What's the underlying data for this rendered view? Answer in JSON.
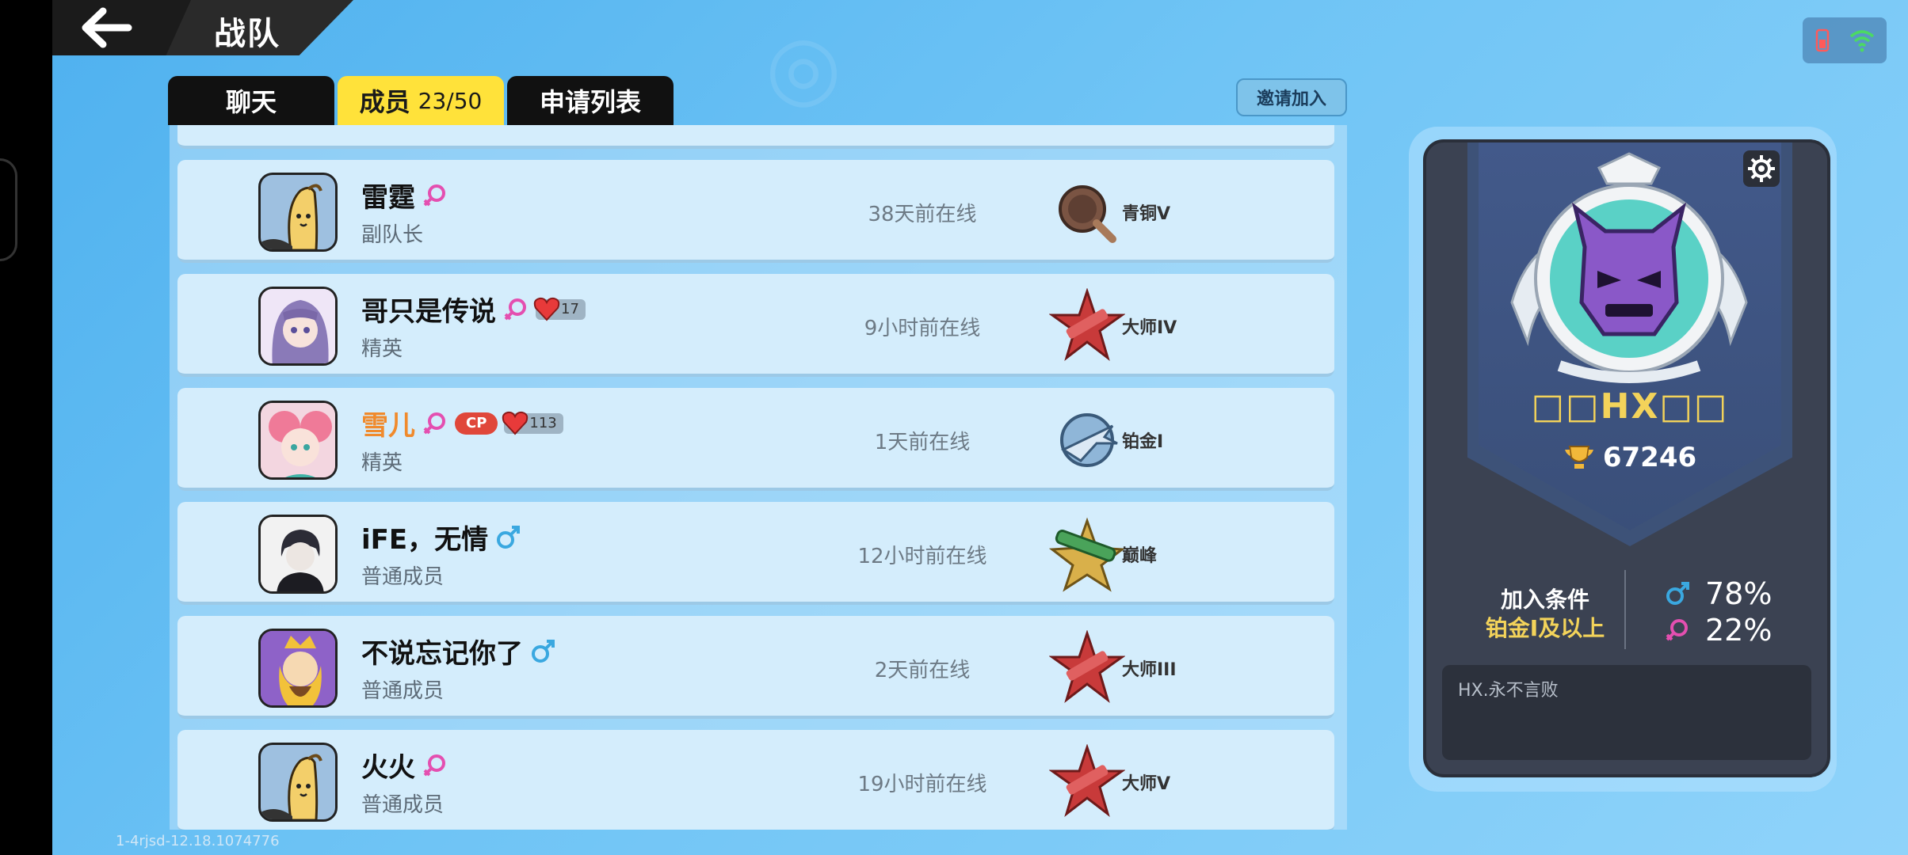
{
  "header": {
    "title": "战队",
    "back_icon": "arrow-left-icon"
  },
  "tabs": [
    {
      "label": "聊天",
      "active": false
    },
    {
      "label": "成员",
      "count": "23/50",
      "active": true
    },
    {
      "label": "申请列表",
      "active": false
    }
  ],
  "invite_label": "邀请加入",
  "members": [
    {
      "name": "雷霆",
      "gender": "female",
      "role": "副队长",
      "online": "38天前在线",
      "rank": "青铜V",
      "rank_icon": "bronze-pan-icon"
    },
    {
      "name": "哥只是传说",
      "gender": "female",
      "hearts": "17",
      "role": "精英",
      "online": "9小时前在线",
      "rank": "大师IV",
      "rank_icon": "master-star-icon"
    },
    {
      "name": "雪儿",
      "gender": "female",
      "cp": "CP",
      "hearts": "113",
      "role": "精英",
      "online": "1天前在线",
      "rank": "铂金I",
      "rank_icon": "platinum-jet-icon"
    },
    {
      "name": "iFE，无情",
      "gender": "male",
      "role": "普通成员",
      "online": "12小时前在线",
      "rank": "巅峰",
      "rank_icon": "peak-rocket-icon"
    },
    {
      "name": "不说忘记你了",
      "gender": "male",
      "role": "普通成员",
      "online": "2天前在线",
      "rank": "大师III",
      "rank_icon": "master-star-icon"
    },
    {
      "name": "火火",
      "gender": "female",
      "role": "普通成员",
      "online": "19小时前在线",
      "rank": "大师V",
      "rank_icon": "master-star-icon"
    }
  ],
  "version": "1-4rjsd-12.18.1074776",
  "clan": {
    "name": "□□HX□□",
    "score": "67246",
    "join_title": "加入条件",
    "join_value": "铂金I及以上",
    "male_pct": "78%",
    "female_pct": "22%",
    "motto": "HX.永不言败"
  },
  "colors": {
    "tab_active": "#ffe23a",
    "accent_gold": "#f3d35a",
    "female": "#e44fb0",
    "male": "#3aa8e0"
  }
}
